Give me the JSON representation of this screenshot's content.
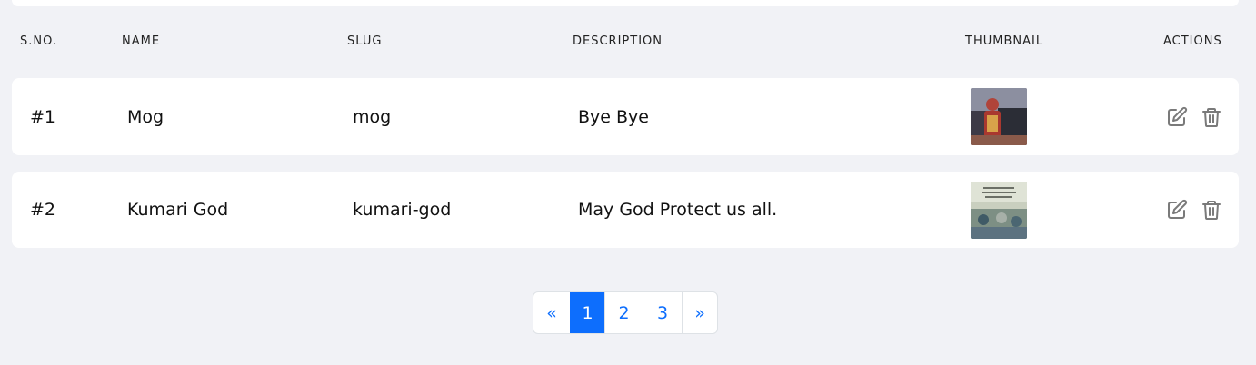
{
  "table": {
    "headers": {
      "sno": "S.NO.",
      "name": "NAME",
      "slug": "SLUG",
      "description": "DESCRIPTION",
      "thumbnail": "THUMBNAIL",
      "actions": "ACTIONS"
    },
    "rows": [
      {
        "sno": "#1",
        "name": "Mog",
        "slug": "mog",
        "description": "Bye Bye",
        "thumbnail_icon": "thumbnail-image"
      },
      {
        "sno": "#2",
        "name": "Kumari God",
        "slug": "kumari-god",
        "description": "May God Protect us all.",
        "thumbnail_icon": "thumbnail-image"
      }
    ],
    "action_icons": [
      "edit-icon",
      "trash-icon"
    ]
  },
  "pagination": {
    "prev": "«",
    "pages": [
      "1",
      "2",
      "3"
    ],
    "active_page": "1",
    "next": "»"
  },
  "colors": {
    "background": "#f1f2f6",
    "card": "#ffffff",
    "accent": "#0d6efd",
    "icon": "#7a7a7a"
  }
}
